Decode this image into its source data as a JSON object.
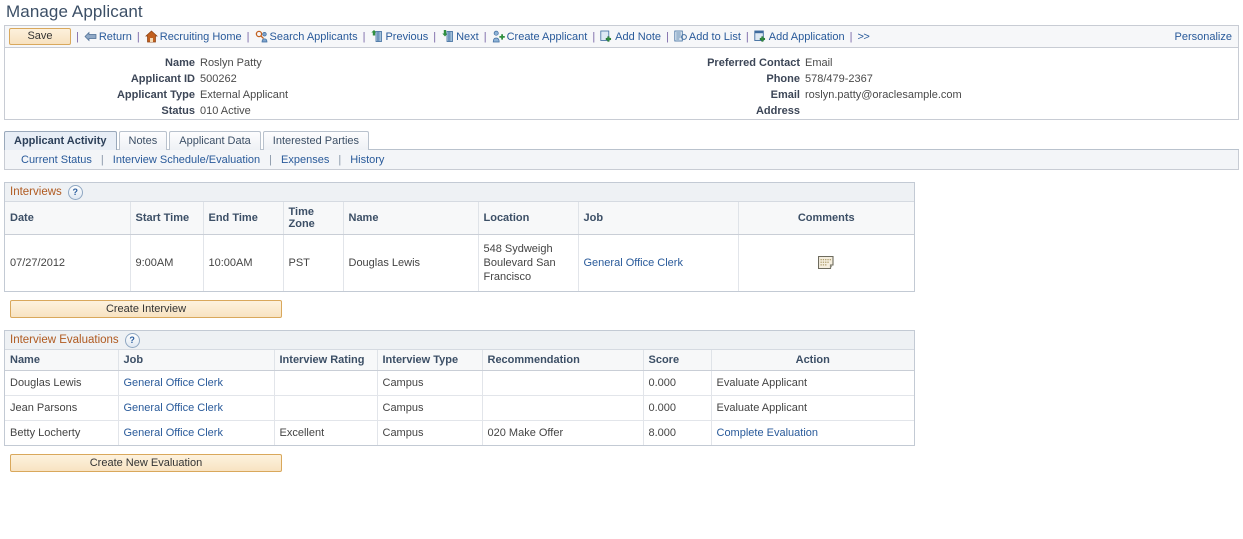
{
  "page": {
    "title": "Manage Applicant"
  },
  "toolbar": {
    "save_label": "Save",
    "separator": "|",
    "more_label": ">>",
    "personalize_label": "Personalize",
    "items": [
      {
        "label": "Return",
        "icon": "back-arrow-icon"
      },
      {
        "label": "Recruiting Home",
        "icon": "home-icon"
      },
      {
        "label": "Search Applicants",
        "icon": "search-applicants-icon"
      },
      {
        "label": "Previous",
        "icon": "previous-icon"
      },
      {
        "label": "Next",
        "icon": "next-icon"
      },
      {
        "label": "Create Applicant",
        "icon": "create-applicant-icon"
      },
      {
        "label": "Add Note",
        "icon": "add-note-icon"
      },
      {
        "label": "Add to List",
        "icon": "add-to-list-icon"
      },
      {
        "label": "Add Application",
        "icon": "add-application-icon"
      }
    ]
  },
  "applicant": {
    "left": [
      {
        "label": "Name",
        "value": "Roslyn Patty"
      },
      {
        "label": "Applicant ID",
        "value": "500262"
      },
      {
        "label": "Applicant Type",
        "value": "External Applicant"
      },
      {
        "label": "Status",
        "value": "010 Active"
      }
    ],
    "right": [
      {
        "label": "Preferred Contact",
        "value": "Email"
      },
      {
        "label": "Phone",
        "value": "578/479-2367"
      },
      {
        "label": "Email",
        "value": "roslyn.patty@oraclesample.com"
      },
      {
        "label": "Address",
        "value": ""
      }
    ]
  },
  "tabs": [
    {
      "label": "Applicant Activity",
      "active": true
    },
    {
      "label": "Notes",
      "active": false
    },
    {
      "label": "Applicant Data",
      "active": false
    },
    {
      "label": "Interested Parties",
      "active": false
    }
  ],
  "subnav": {
    "separator": "|",
    "items": [
      {
        "label": "Current Status"
      },
      {
        "label": "Interview Schedule/Evaluation"
      },
      {
        "label": "Expenses"
      },
      {
        "label": "History"
      }
    ]
  },
  "interviews": {
    "section_title": "Interviews",
    "help_icon": "help-icon",
    "columns": [
      "Date",
      "Start Time",
      "End Time",
      "Time Zone",
      "Name",
      "Location",
      "Job",
      "Comments"
    ],
    "rows": [
      {
        "date": "07/27/2012",
        "start_time": "9:00AM",
        "end_time": "10:00AM",
        "time_zone": "PST",
        "name": "Douglas Lewis",
        "location": "548 Sydweigh Boulevard San Francisco",
        "job": "General Office Clerk",
        "comments_icon": "comments-icon"
      }
    ],
    "create_button": "Create Interview"
  },
  "evaluations": {
    "section_title": "Interview Evaluations",
    "help_icon": "help-icon",
    "columns": [
      "Name",
      "Job",
      "Interview Rating",
      "Interview Type",
      "Recommendation",
      "Score",
      "Action"
    ],
    "rows": [
      {
        "name": "Douglas Lewis",
        "job": "General Office Clerk",
        "rating": "",
        "type": "Campus",
        "recommendation": "",
        "score": "0.000",
        "action": "Evaluate Applicant",
        "action_is_link": false
      },
      {
        "name": "Jean Parsons",
        "job": "General Office Clerk",
        "rating": "",
        "type": "Campus",
        "recommendation": "",
        "score": "0.000",
        "action": "Evaluate Applicant",
        "action_is_link": false
      },
      {
        "name": "Betty Locherty",
        "job": "General Office Clerk",
        "rating": "Excellent",
        "type": "Campus",
        "recommendation": "020 Make Offer",
        "score": "8.000",
        "action": "Complete Evaluation",
        "action_is_link": true
      }
    ],
    "create_button": "Create New Evaluation"
  },
  "colors": {
    "link": "#295a9a",
    "section_title": "#b05a20",
    "button_border": "#d9a85c",
    "panel_border": "#c8ccd4"
  }
}
